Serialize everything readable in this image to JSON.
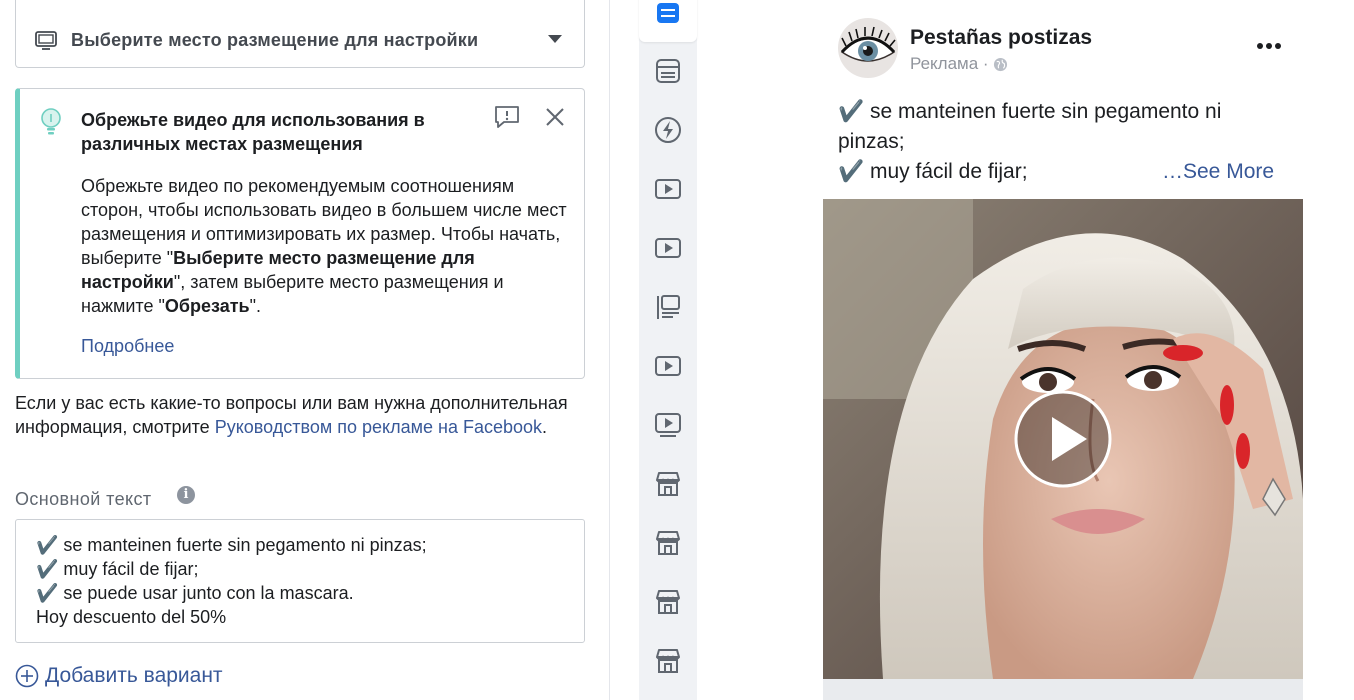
{
  "placement": {
    "label": "Выберите место размещение для настройки",
    "icon": "monitor-icon"
  },
  "tip": {
    "title": "Обрежьте видео для использования в различных местах размещения",
    "body_1": "Обрежьте видео по рекомендуемым соотношениям сторон, чтобы использовать видео в большем числе мест размещения и оптимизировать их размер. Чтобы начать, выберите \"",
    "body_bold_1": "Выберите место размещение для настройки",
    "body_2": "\", затем выберите место размещения и нажмите \"",
    "body_bold_2": "Обрезать",
    "body_3": "\".",
    "learn_more": "Подробнее",
    "accent_color": "#6fcfc1"
  },
  "help": {
    "text_1": "Если у вас есть какие-то вопросы или вам нужна дополнительная информация, смотрите ",
    "link": "Руководством по рекламе на Facebook",
    "text_2": "."
  },
  "primary_text": {
    "label": "Основной текст",
    "lines": [
      "✔️ se manteinen fuerte sin pegamento ni pinzas;",
      "✔️ muy fácil de fijar;",
      "✔️ se puede usar junto con la mascara.",
      "Hoy descuento del 50%"
    ]
  },
  "add_variant": "Добавить вариант",
  "rail": {
    "items": [
      "feed-icon",
      "feed-icon",
      "instant-articles-icon",
      "video-icon",
      "video-icon",
      "list-icon",
      "video-icon",
      "video-feed-icon",
      "marketplace-icon",
      "marketplace-icon",
      "marketplace-icon",
      "marketplace-icon"
    ],
    "active_index": 0
  },
  "preview": {
    "page_name": "Pestañas postizas",
    "sponsored": "Реклама ·",
    "line_1": "✔️ se manteinen fuerte sin pegamento ni pinzas;",
    "line_2": "✔️ muy fácil de fijar;",
    "see_more": "…See More",
    "link_color": "#385898"
  }
}
